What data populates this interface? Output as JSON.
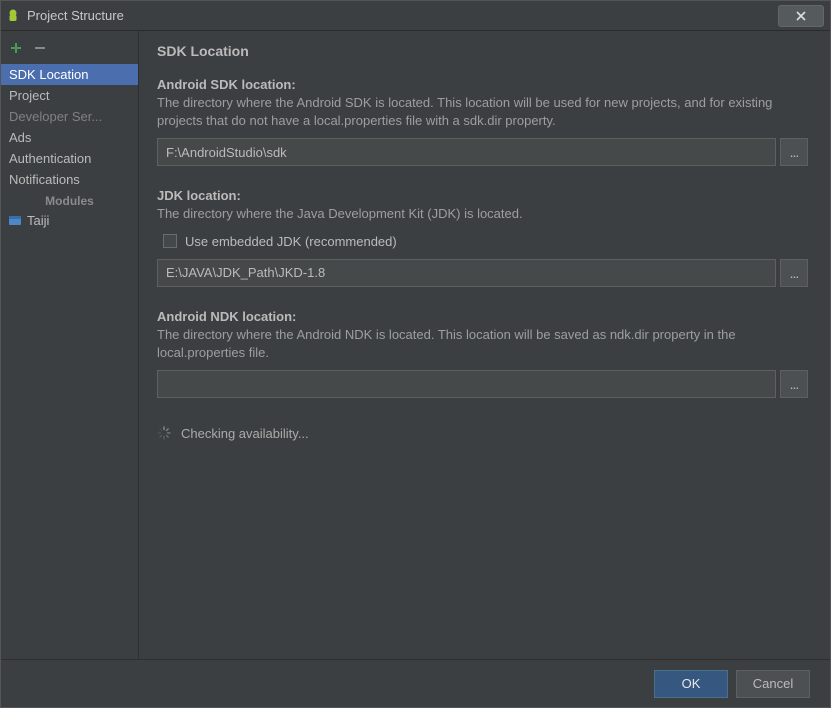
{
  "window": {
    "title": "Project Structure"
  },
  "sidebar": {
    "items": [
      {
        "label": "SDK Location",
        "selected": true
      },
      {
        "label": "Project"
      },
      {
        "label": "Developer Ser...",
        "muted": true
      },
      {
        "label": "Ads"
      },
      {
        "label": "Authentication"
      },
      {
        "label": "Notifications"
      }
    ],
    "modules_heading": "Modules",
    "modules": [
      {
        "label": "Taiji"
      }
    ]
  },
  "main": {
    "heading": "SDK Location",
    "sdk": {
      "label": "Android SDK location:",
      "desc": "The directory where the Android SDK is located. This location will be used for new projects, and for existing projects that do not have a local.properties file with a sdk.dir property.",
      "value": "F:\\AndroidStudio\\sdk"
    },
    "jdk": {
      "label": "JDK location:",
      "desc": "The directory where the Java Development Kit (JDK) is located.",
      "checkbox_label": "Use embedded JDK (recommended)",
      "value": "E:\\JAVA\\JDK_Path\\JKD-1.8"
    },
    "ndk": {
      "label": "Android NDK location:",
      "desc": "The directory where the Android NDK is located. This location will be saved as ndk.dir property in the local.properties file.",
      "value": ""
    },
    "status": "Checking availability..."
  },
  "footer": {
    "ok": "OK",
    "cancel": "Cancel"
  },
  "browse_label": "..."
}
